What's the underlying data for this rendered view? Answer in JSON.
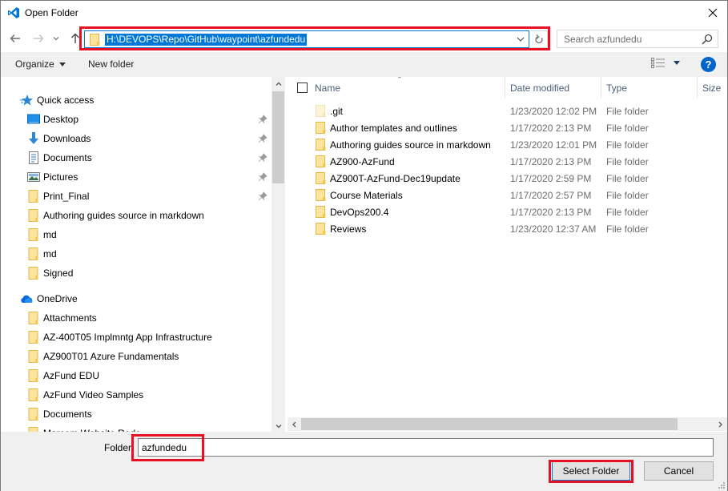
{
  "window": {
    "title": "Open Folder",
    "app_icon": "vscode-logo-icon",
    "close_icon": "close-icon"
  },
  "nav": {
    "back_icon": "arrow-left-icon",
    "forward_icon": "arrow-right-icon",
    "recent_icon": "chevron-down-icon",
    "up_icon": "arrow-up-icon",
    "address_path": "H:\\DEVOPS\\Repo\\GitHub\\waypoint\\azfundedu",
    "refresh_icon": "refresh-icon",
    "search_placeholder": "Search azfundedu"
  },
  "toolbar": {
    "organize_label": "Organize",
    "new_folder_label": "New folder",
    "help_label": "?"
  },
  "sidebar": {
    "quick_access_label": "Quick access",
    "quick_access_items": [
      {
        "label": "Desktop",
        "icon": "desktop-icon",
        "pinned": true
      },
      {
        "label": "Downloads",
        "icon": "download-icon",
        "pinned": true
      },
      {
        "label": "Documents",
        "icon": "document-icon",
        "pinned": true
      },
      {
        "label": "Pictures",
        "icon": "pictures-icon",
        "pinned": true
      },
      {
        "label": "Print_Final",
        "icon": "folder-icon",
        "pinned": true
      },
      {
        "label": "Authoring guides source in markdown",
        "icon": "folder-icon",
        "pinned": false
      },
      {
        "label": "md",
        "icon": "folder-icon",
        "pinned": false
      },
      {
        "label": "md",
        "icon": "folder-icon",
        "pinned": false
      },
      {
        "label": "Signed",
        "icon": "folder-icon",
        "pinned": false
      }
    ],
    "onedrive_label": "OneDrive",
    "onedrive_items": [
      {
        "label": "Attachments"
      },
      {
        "label": "AZ-400T05 Implmntg App Infrastructure"
      },
      {
        "label": "AZ900T01 Azure Fundamentals"
      },
      {
        "label": "AzFund EDU"
      },
      {
        "label": "AzFund Video Samples"
      },
      {
        "label": "Documents"
      },
      {
        "label": "Marcom Website Redo"
      }
    ]
  },
  "filelist": {
    "columns": {
      "name": "Name",
      "date": "Date modified",
      "type": "Type",
      "size": "Size"
    },
    "rows": [
      {
        "name": ".git",
        "date": "1/23/2020 12:02 PM",
        "type": "File folder",
        "hidden": true
      },
      {
        "name": "Author templates and outlines",
        "date": "1/17/2020 2:13 PM",
        "type": "File folder",
        "hidden": false
      },
      {
        "name": "Authoring guides source in markdown",
        "date": "1/23/2020 12:01 PM",
        "type": "File folder",
        "hidden": false
      },
      {
        "name": "AZ900-AzFund",
        "date": "1/17/2020 2:13 PM",
        "type": "File folder",
        "hidden": false
      },
      {
        "name": "AZ900T-AzFund-Dec19update",
        "date": "1/17/2020 2:59 PM",
        "type": "File folder",
        "hidden": false
      },
      {
        "name": "Course Materials",
        "date": "1/17/2020 2:57 PM",
        "type": "File folder",
        "hidden": false
      },
      {
        "name": "DevOps200.4",
        "date": "1/17/2020 2:13 PM",
        "type": "File folder",
        "hidden": false
      },
      {
        "name": "Reviews",
        "date": "1/23/2020 12:37 AM",
        "type": "File folder",
        "hidden": false
      }
    ]
  },
  "bottom": {
    "folder_label": "Folder:",
    "folder_value": "azfundedu",
    "select_label": "Select Folder",
    "cancel_label": "Cancel"
  },
  "colors": {
    "accent": "#0078d7",
    "highlight_annotation": "#e81123",
    "folder_yellow": "#f8d775",
    "toolbar_bg": "#f0f0f0",
    "header_text": "#4c607a"
  }
}
